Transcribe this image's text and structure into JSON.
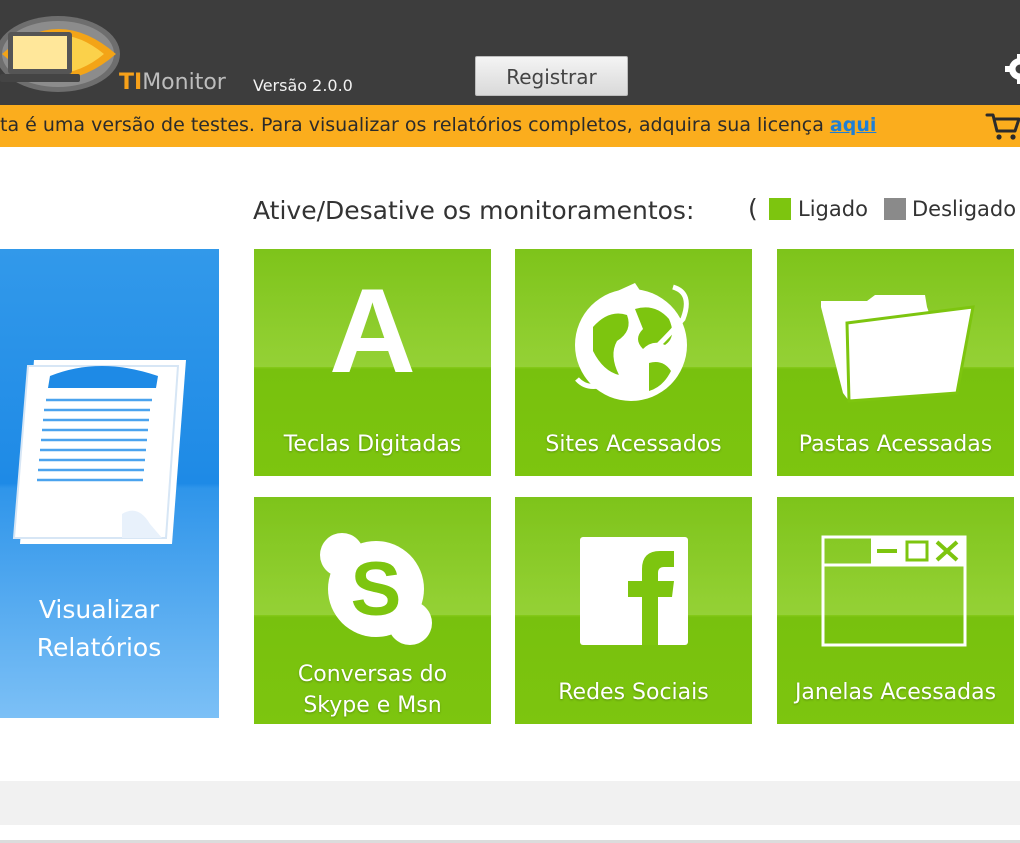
{
  "header": {
    "brand_ti": "TI",
    "brand_rest": "Monitor",
    "version": "Versão 2.0.0",
    "register_label": "Registrar"
  },
  "notice": {
    "text": "ta é uma versão de testes. Para visualizar os relatórios completos, adquira sua licença ",
    "link": "aqui"
  },
  "monitor": {
    "prompt": "Ative/Desative os monitoramentos:",
    "legend_open": "(",
    "legend_on": "Ligado",
    "legend_off": "Desligado"
  },
  "reports": {
    "line1": "Visualizar",
    "line2": "Relatórios"
  },
  "tiles": [
    {
      "line1": "Teclas Digitadas",
      "letter": "A"
    },
    {
      "line1": "Sites Acessados"
    },
    {
      "line1": "Pastas Acessadas"
    },
    {
      "line1": "Conversas do",
      "line2": "Skype e Msn"
    },
    {
      "line1": "Redes Sociais"
    },
    {
      "line1": "Janelas Acessadas"
    }
  ],
  "colors": {
    "header_bg": "#3d3d3d",
    "notice_bg": "#fbad1d",
    "tile_green": "#7dc50f",
    "reports_blue": "#1e8ae6",
    "legend_on": "#7dc50f",
    "legend_off": "#8a8a8a"
  },
  "icons": [
    "app-logo-icon",
    "gear-icon",
    "cart-icon",
    "document-icon",
    "globe-icon",
    "folder-icon",
    "skype-icon",
    "facebook-icon",
    "window-icon"
  ]
}
